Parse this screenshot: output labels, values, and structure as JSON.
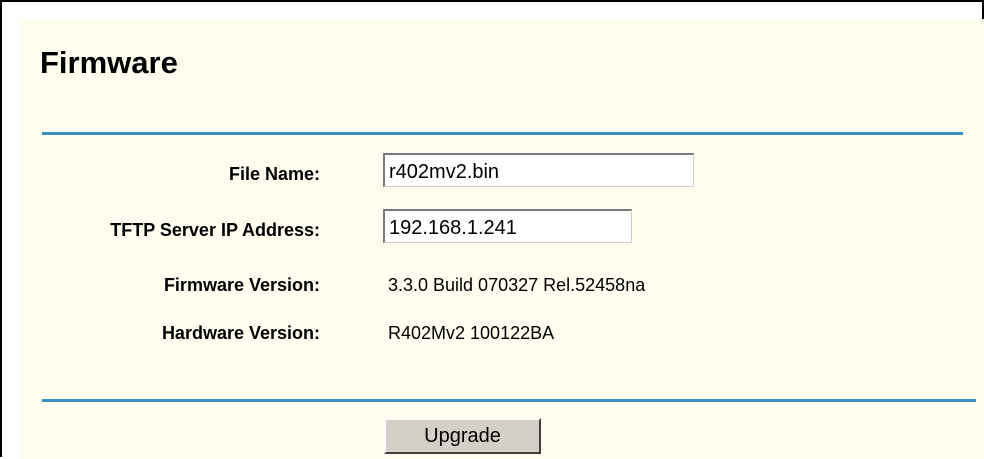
{
  "page": {
    "title": "Firmware"
  },
  "form": {
    "file_name": {
      "label": "File Name:",
      "value": "r402mv2.bin"
    },
    "tftp_server": {
      "label": "TFTP Server IP Address:",
      "value": "192.168.1.241"
    },
    "firmware_version": {
      "label": "Firmware Version:",
      "value": "3.3.0 Build 070327 Rel.52458na"
    },
    "hardware_version": {
      "label": "Hardware Version:",
      "value": "R402Mv2 100122BA"
    }
  },
  "actions": {
    "upgrade_label": "Upgrade"
  },
  "colors": {
    "panel_background": "#fffcf0",
    "rule": "#3b8fbd",
    "button_face": "#d4d0c8"
  }
}
